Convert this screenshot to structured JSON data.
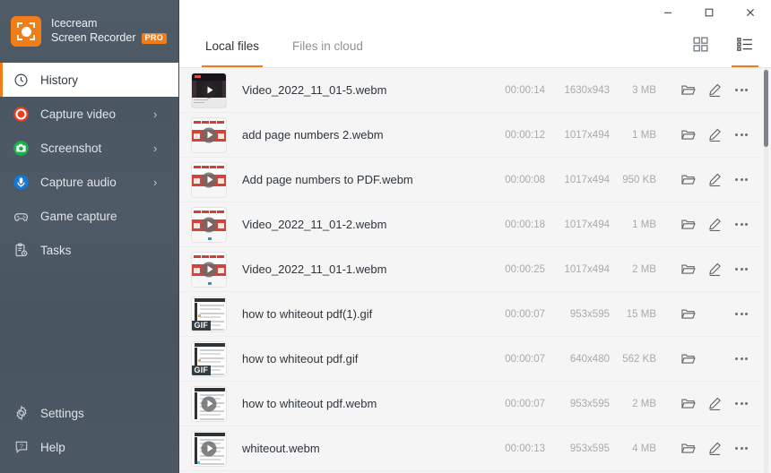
{
  "app": {
    "brand_line1": "Icecream",
    "brand_line2": "Screen Recorder",
    "pro_badge": "PRO"
  },
  "window_controls": {
    "minimize": "minimize-icon",
    "maximize": "maximize-icon",
    "close": "close-icon"
  },
  "sidebar": {
    "items": [
      {
        "label": "History",
        "icon": "clock-icon",
        "active": true,
        "chevron": false
      },
      {
        "label": "Capture video",
        "icon": "record-video-icon",
        "active": false,
        "chevron": true,
        "chevron_glyph": "›"
      },
      {
        "label": "Screenshot",
        "icon": "camera-icon",
        "active": false,
        "chevron": true,
        "chevron_glyph": "›"
      },
      {
        "label": "Capture audio",
        "icon": "microphone-icon",
        "active": false,
        "chevron": true,
        "chevron_glyph": "›"
      },
      {
        "label": "Game capture",
        "icon": "gamepad-icon",
        "active": false,
        "chevron": false
      },
      {
        "label": "Tasks",
        "icon": "clipboard-clock-icon",
        "active": false,
        "chevron": false
      }
    ],
    "bottom_items": [
      {
        "label": "Settings",
        "icon": "gear-icon"
      },
      {
        "label": "Help",
        "icon": "help-icon"
      }
    ]
  },
  "tabs": [
    {
      "label": "Local files",
      "active": true
    },
    {
      "label": "Files in cloud",
      "active": false
    }
  ],
  "view_toggles": [
    {
      "name": "grid-view",
      "icon": "grid-icon",
      "active": false
    },
    {
      "name": "list-view",
      "icon": "list-icon",
      "active": true
    }
  ],
  "files": [
    {
      "name": "Video_2022_11_01-5.webm",
      "duration": "00:00:14",
      "resolution": "1630x943",
      "size": "3 MB",
      "thumb": "dark-video",
      "has_edit": true
    },
    {
      "name": "add page numbers 2.webm",
      "duration": "00:00:12",
      "resolution": "1017x494",
      "size": "1 MB",
      "thumb": "pdf-video",
      "has_edit": true
    },
    {
      "name": "Add page numbers to PDF.webm",
      "duration": "00:00:08",
      "resolution": "1017x494",
      "size": "950 KB",
      "thumb": "pdf-video",
      "has_edit": true
    },
    {
      "name": "Video_2022_11_01-2.webm",
      "duration": "00:00:18",
      "resolution": "1017x494",
      "size": "1 MB",
      "thumb": "pdf-video",
      "has_edit": true
    },
    {
      "name": "Video_2022_11_01-1.webm",
      "duration": "00:00:25",
      "resolution": "1017x494",
      "size": "2 MB",
      "thumb": "pdf-video",
      "has_edit": true
    },
    {
      "name": "how to whiteout pdf(1).gif",
      "duration": "00:00:07",
      "resolution": "953x595",
      "size": "15 MB",
      "thumb": "gif-doc",
      "has_edit": false
    },
    {
      "name": "how to whiteout pdf.gif",
      "duration": "00:00:07",
      "resolution": "640x480",
      "size": "562 KB",
      "thumb": "gif-doc",
      "has_edit": false
    },
    {
      "name": "how to whiteout pdf.webm",
      "duration": "00:00:07",
      "resolution": "953x595",
      "size": "2 MB",
      "thumb": "doc-video",
      "has_edit": true
    },
    {
      "name": "whiteout.webm",
      "duration": "00:00:13",
      "resolution": "953x595",
      "size": "4 MB",
      "thumb": "doc-video",
      "has_edit": true
    }
  ],
  "row_actions": {
    "open_folder": "folder-icon",
    "edit": "pencil-icon",
    "more": "more-options-icon"
  },
  "gif_badge_label": "GIF",
  "colors": {
    "accent": "#f07d18",
    "sidebar": "#4b5763",
    "content_bg": "#f5f5f5"
  }
}
